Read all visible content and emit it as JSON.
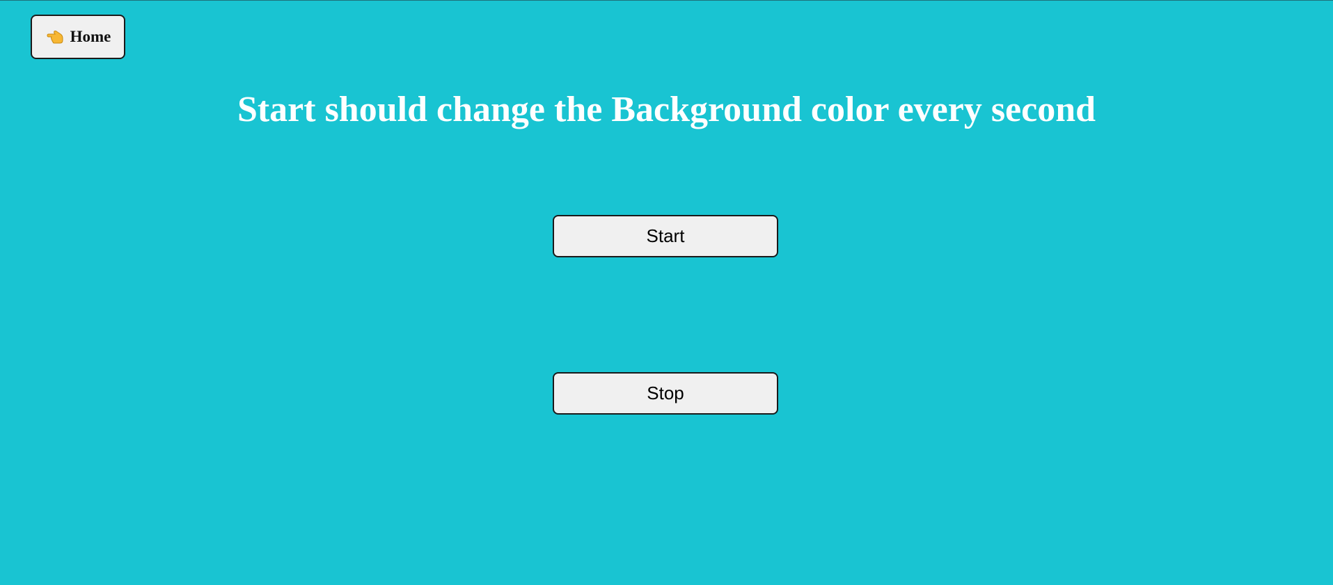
{
  "colors": {
    "background": "#19c4d2",
    "title_text": "#ffffff",
    "button_bg": "#f0f0f0",
    "button_border": "#1a1a1a"
  },
  "nav": {
    "home_icon": "pointing-hand-icon",
    "home_label": "Home"
  },
  "main": {
    "title": "Start should change the Background color every second",
    "start_label": "Start",
    "stop_label": "Stop"
  }
}
